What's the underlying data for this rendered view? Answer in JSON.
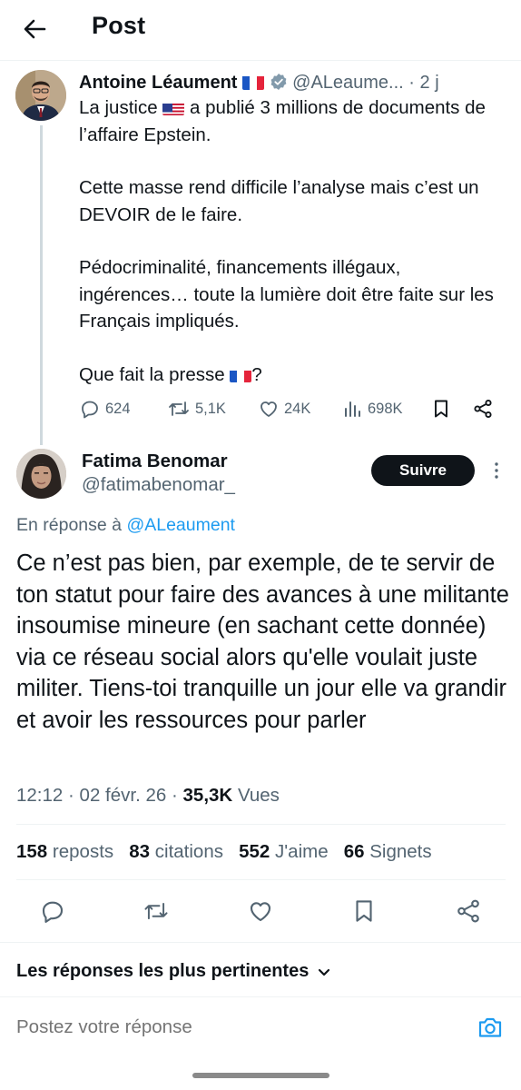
{
  "header": {
    "title": "Post"
  },
  "original": {
    "name": "Antoine Léaument",
    "handle": "@ALeaume...",
    "separator": "·",
    "time": "2 j",
    "text1a": "La justice",
    "text1b": "a publié 3 millions de documents de l’affaire Epstein.",
    "text2": "Cette masse rend difficile l’analyse mais c’est un DEVOIR de le faire.",
    "text3": "Pédocriminalité, financements illégaux, ingérences… toute la lumière doit être faite sur les Français impliqués.",
    "text4a": "Que fait la presse",
    "text4b": "?",
    "replies": "624",
    "reposts": "5,1K",
    "likes": "24K",
    "views": "698K"
  },
  "reply": {
    "name": "Fatima Benomar",
    "handle": "@fatimabenomar_",
    "follow_label": "Suivre",
    "reply_to_prefix": "En réponse à",
    "reply_to_handle": "@ALeaument",
    "text": "Ce n’est pas bien, par exemple, de te servir de ton statut pour faire des avances à une militante insoumise mineure (en sachant cette donnée) via ce réseau social alors qu'elle voulait juste militer. Tiens-toi tranquille un jour elle va grandir et avoir les ressources pour parler",
    "time": "12:12",
    "date": "02 févr. 26",
    "dot": "·",
    "views_count": "35,3K",
    "views_label": "Vues"
  },
  "stats": {
    "reposts_count": "158",
    "reposts_label": "reposts",
    "quotes_count": "83",
    "quotes_label": "citations",
    "likes_count": "552",
    "likes_label": "J'aime",
    "bookmarks_count": "66",
    "bookmarks_label": "Signets"
  },
  "sort": {
    "label": "Les réponses les plus pertinentes"
  },
  "composer": {
    "placeholder": "Postez votre réponse"
  },
  "colors": {
    "accent": "#1d9bf0",
    "muted": "#536471",
    "text": "#0f1419",
    "verified": "#829aab"
  },
  "icons": [
    "back-arrow-icon",
    "verified-icon",
    "french-flag-icon",
    "us-flag-icon",
    "reply-icon",
    "repost-icon",
    "like-icon",
    "views-icon",
    "bookmark-icon",
    "share-icon",
    "more-vertical-icon",
    "chevron-down-icon",
    "camera-icon"
  ]
}
